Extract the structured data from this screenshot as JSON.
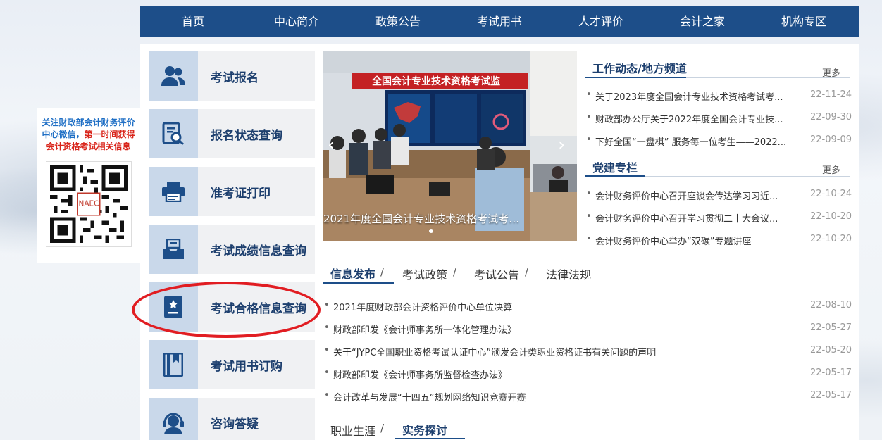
{
  "nav": [
    {
      "label": "首页"
    },
    {
      "label": "中心简介"
    },
    {
      "label": "政策公告"
    },
    {
      "label": "考试用书"
    },
    {
      "label": "人才评价"
    },
    {
      "label": "会计之家"
    },
    {
      "label": "机构专区"
    }
  ],
  "qr": {
    "line1": "关注财政部会计财务评价",
    "line2_blue": "中心微信，",
    "line2_red": "第一时间获得",
    "line3": "会计资格考试相关信息",
    "logo": "NAEC"
  },
  "menu": [
    {
      "label": "考试报名",
      "icon": "users-icon"
    },
    {
      "label": "报名状态查询",
      "icon": "document-search-icon"
    },
    {
      "label": "准考证打印",
      "icon": "printer-icon"
    },
    {
      "label": "考试成绩信息查询",
      "icon": "inbox-icon"
    },
    {
      "label": "考试合格信息查询",
      "icon": "certificate-icon"
    },
    {
      "label": "考试用书订购",
      "icon": "book-icon"
    },
    {
      "label": "咨询答疑",
      "icon": "headset-icon"
    }
  ],
  "carousel": {
    "caption": "2021年度全国会计专业技术资格考试考务会议在...",
    "screen_text": "全国会计专业技术资格考试监"
  },
  "work_news": {
    "title": "工作动态/地方频道",
    "more": "更多",
    "items": [
      {
        "title": "关于2023年度全国会计专业技术资格考试考...",
        "date": "22-11-24"
      },
      {
        "title": "财政部办公厅关于2022年度全国会计专业技...",
        "date": "22-09-30"
      },
      {
        "title": "下好全国“一盘棋” 服务每一位考生——2022...",
        "date": "22-09-09"
      }
    ]
  },
  "party_news": {
    "title": "党建专栏",
    "more": "更多",
    "items": [
      {
        "title": "会计财务评价中心召开座谈会传达学习习近...",
        "date": "22-10-24"
      },
      {
        "title": "会计财务评价中心召开学习贯彻二十大会议...",
        "date": "22-10-20"
      },
      {
        "title": "会计财务评价中心举办“双碳”专题讲座",
        "date": "22-10-20"
      }
    ]
  },
  "info_tabs": {
    "tabs": [
      "信息发布",
      "考试政策",
      "考试公告",
      "法律法规"
    ],
    "separator": "/",
    "items": [
      {
        "title": "2021年度财政部会计资格评价中心单位决算",
        "date": "22-08-10"
      },
      {
        "title": "财政部印发《会计师事务所一体化管理办法》",
        "date": "22-05-27"
      },
      {
        "title": "关于“JYPC全国职业资格考试认证中心”颁发会计类职业资格证书有关问题的声明",
        "date": "22-05-20"
      },
      {
        "title": "财政部印发《会计师事务所监督检查办法》",
        "date": "22-05-17"
      },
      {
        "title": "会计改革与发展“十四五”规划网络知识竞赛开赛",
        "date": "22-05-17"
      }
    ]
  },
  "bottom_tabs": {
    "tabs": [
      "职业生涯",
      "实务探讨"
    ],
    "separator": "/"
  },
  "colors": {
    "nav_bg": "#1d4e89",
    "accent_text": "#1d3f6e",
    "icon_box": "#c9d8ea",
    "highlight_circle": "#e11d22"
  }
}
